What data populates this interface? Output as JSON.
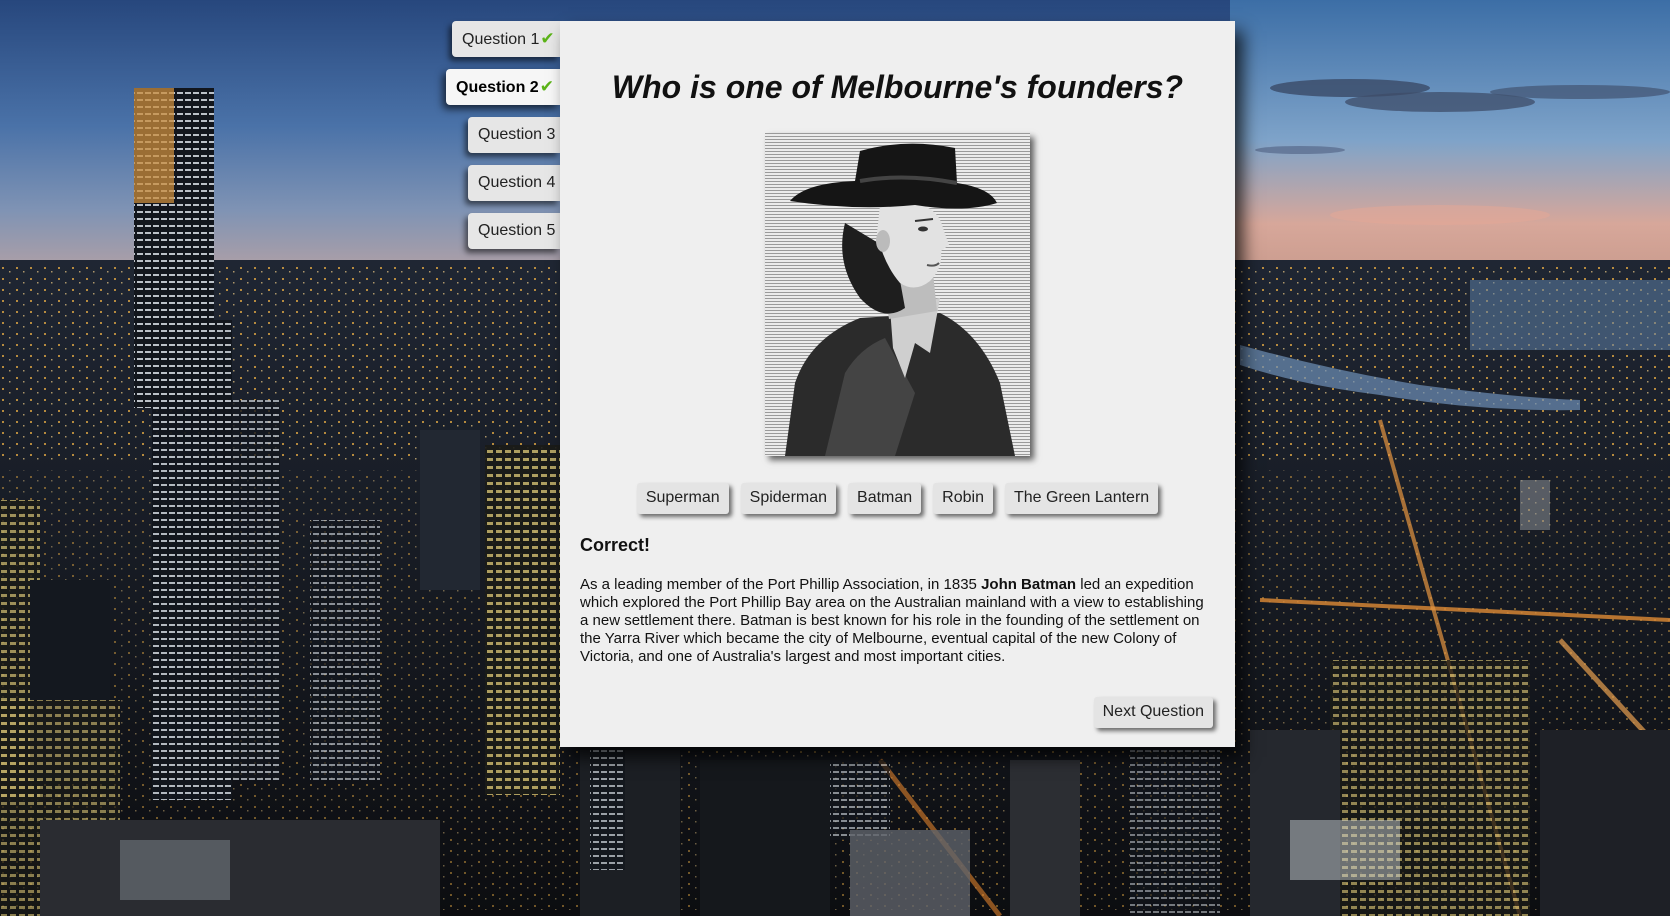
{
  "colors": {
    "card_background": "#efefef",
    "tab_background": "#e6e6e6",
    "check_color": "#5bb318",
    "button_background": "#e4e4e4"
  },
  "sidebar": {
    "tabs": [
      {
        "label": "Question 1",
        "completed": true,
        "active": false
      },
      {
        "label": "Question 2",
        "completed": true,
        "active": true
      },
      {
        "label": "Question 3",
        "completed": false,
        "active": false
      },
      {
        "label": "Question 4",
        "completed": false,
        "active": false
      },
      {
        "label": "Question 5",
        "completed": false,
        "active": false
      }
    ],
    "check_glyph": "✔"
  },
  "question": {
    "title": "Who is one of Melbourne's founders?",
    "image_icon": "portrait-engraving",
    "answers": [
      "Superman",
      "Spiderman",
      "Batman",
      "Robin",
      "The Green Lantern"
    ]
  },
  "feedback": {
    "result": "Correct!",
    "text_before": "As a leading member of the Port Phillip Association, in 1835 ",
    "highlight": "John Batman",
    "text_after": " led an expedition which explored the Port Phillip Bay area on the Australian mainland with a view to establishing a new settlement there. Batman is best known for his role in the founding of the settlement on the Yarra River which became the city of Melbourne, eventual capital of the new Colony of Victoria, and one of Australia's largest and most important cities."
  },
  "actions": {
    "next_label": "Next Question"
  }
}
